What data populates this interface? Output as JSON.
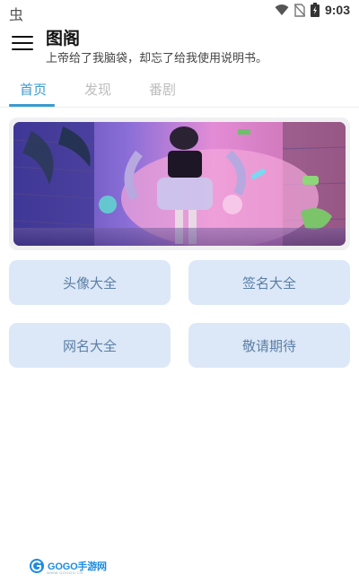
{
  "status_bar": {
    "left_glyph": "虫",
    "time": "9:03",
    "icons": [
      "wifi-icon",
      "no-sim-icon",
      "battery-charging-icon"
    ]
  },
  "header": {
    "title": "图阁",
    "subtitle": "上帝给了我脑袋，却忘了给我使用说明书。",
    "menu_icon": "hamburger-menu-icon"
  },
  "tabs": [
    {
      "label": "首页",
      "active": true
    },
    {
      "label": "发现",
      "active": false
    },
    {
      "label": "番剧",
      "active": false
    }
  ],
  "banner": {
    "image": "banner-photo"
  },
  "grid": [
    {
      "label": "头像大全"
    },
    {
      "label": "签名大全"
    },
    {
      "label": "网名大全"
    },
    {
      "label": "敬请期待"
    }
  ],
  "watermark": {
    "text": "GOGO手游网",
    "url": "WWW.GOGOO.CN"
  },
  "colors": {
    "accent": "#3a9bd0",
    "button_bg": "#dce8f7",
    "button_text": "#5b7ea6",
    "tab_inactive": "#bdbdbd"
  }
}
